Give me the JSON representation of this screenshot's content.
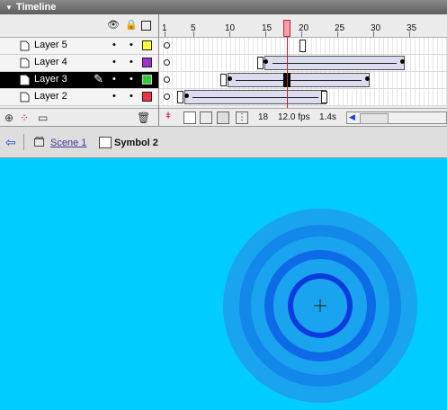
{
  "panel": {
    "title": "Timeline",
    "collapse_icon": "triangle-down-icon"
  },
  "header_icons": [
    "eye-icon",
    "lock-icon",
    "outline-icon"
  ],
  "layers": [
    {
      "name": "Layer 5",
      "color": "#ffff33",
      "selected": false
    },
    {
      "name": "Layer 4",
      "color": "#9933cc",
      "selected": false
    },
    {
      "name": "Layer 3",
      "color": "#33cc33",
      "selected": true
    },
    {
      "name": "Layer 2",
      "color": "#ee3344",
      "selected": false
    }
  ],
  "ruler": {
    "labels": [
      "1",
      "5",
      "10",
      "15",
      "20",
      "25",
      "30",
      "35"
    ]
  },
  "status": {
    "current_frame": "18",
    "frame_rate": "12.0 fps",
    "elapsed": "1.4s"
  },
  "footer_icons": [
    "insert-layer-icon",
    "add-motion-guide-icon",
    "insert-folder-icon",
    "delete-layer-icon"
  ],
  "breadcrumb": {
    "back_icon": "back-arrow-icon",
    "scene": "Scene 1",
    "symbol": "Symbol 2"
  },
  "stage": {
    "background": "#00ccff",
    "registration_icon": "crosshair-icon"
  }
}
